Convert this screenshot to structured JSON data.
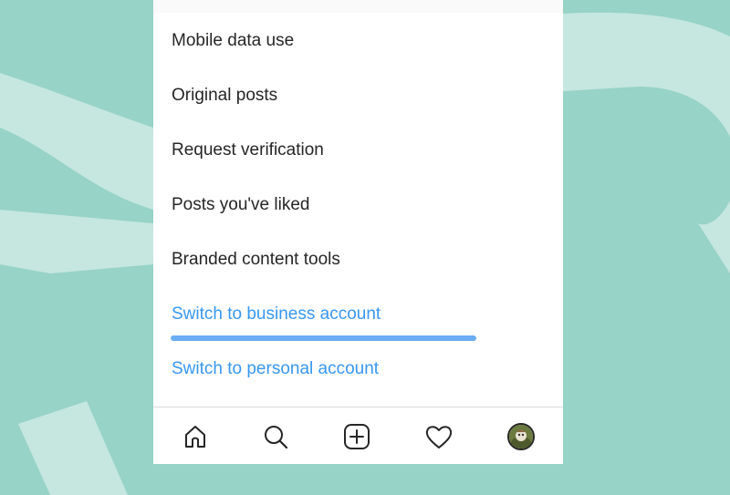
{
  "theme": {
    "background": "#97d3c6",
    "background_shape": "#c5e7e0",
    "link_color": "#3897f0",
    "highlight_color": "#6aacf2",
    "text_color": "#262626"
  },
  "settings_menu": {
    "items": [
      {
        "label": "Mobile data use"
      },
      {
        "label": "Original posts"
      },
      {
        "label": "Request verification"
      },
      {
        "label": "Posts you've liked"
      },
      {
        "label": "Branded content tools"
      },
      {
        "label": "Switch to business account"
      },
      {
        "label": "Switch to personal account"
      }
    ]
  },
  "tab_bar": {
    "tabs": [
      {
        "icon": "home-icon"
      },
      {
        "icon": "search-icon"
      },
      {
        "icon": "new-post-icon"
      },
      {
        "icon": "heart-icon"
      },
      {
        "icon": "profile-avatar"
      }
    ]
  }
}
